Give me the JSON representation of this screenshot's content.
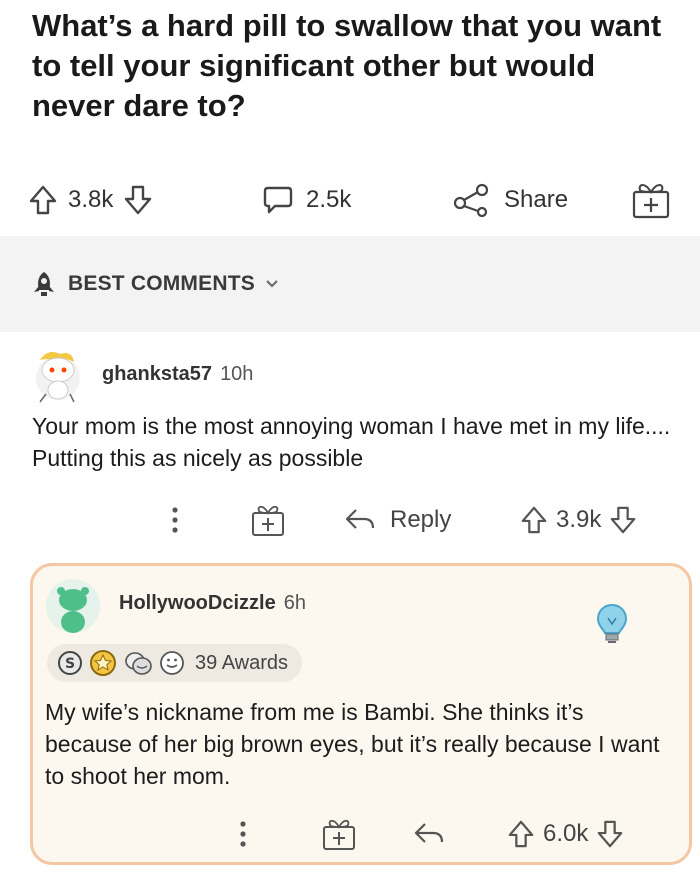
{
  "post": {
    "title": "What’s a hard pill to swallow that you want to tell your significant other but would never dare to?",
    "upvotes": "3.8k",
    "comments": "2.5k",
    "share_label": "Share"
  },
  "comments_section": {
    "sort_label": "BEST COMMENTS"
  },
  "comments": [
    {
      "username": "ghanksta57",
      "age": "10h",
      "body": "Your mom is the most annoying woman I have met in my life.... Putting this as nicely as possible",
      "reply_label": "Reply",
      "score": "3.9k"
    },
    {
      "username": "HollywooDcizzle",
      "age": "6h",
      "awards_label": "39 Awards",
      "body": "My wife’s nickname from me is Bambi. She thinks it’s because of her big brown eyes, but it’s really because I want to shoot her mom.",
      "score": "6.0k"
    }
  ],
  "colors": {
    "highlight_border": "#f4c6a4",
    "highlight_bg": "#fdf8ef",
    "section_bg": "#f3f3f4"
  }
}
